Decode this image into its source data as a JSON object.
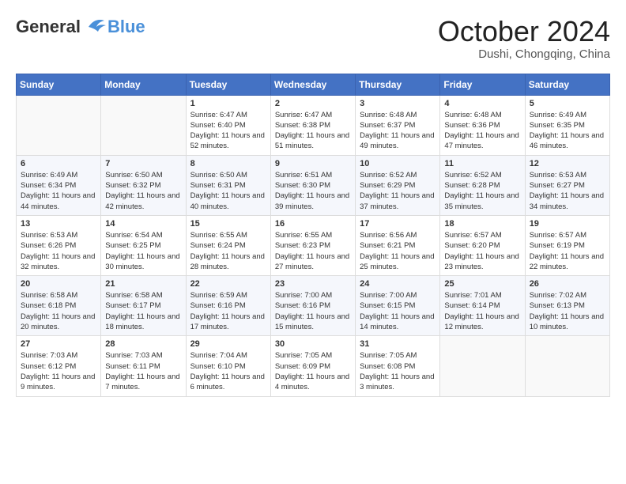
{
  "header": {
    "logo_general": "General",
    "logo_blue": "Blue",
    "month_title": "October 2024",
    "location": "Dushi, Chongqing, China"
  },
  "weekdays": [
    "Sunday",
    "Monday",
    "Tuesday",
    "Wednesday",
    "Thursday",
    "Friday",
    "Saturday"
  ],
  "weeks": [
    [
      {
        "day": "",
        "sunrise": "",
        "sunset": "",
        "daylight": ""
      },
      {
        "day": "",
        "sunrise": "",
        "sunset": "",
        "daylight": ""
      },
      {
        "day": "1",
        "sunrise": "Sunrise: 6:47 AM",
        "sunset": "Sunset: 6:40 PM",
        "daylight": "Daylight: 11 hours and 52 minutes."
      },
      {
        "day": "2",
        "sunrise": "Sunrise: 6:47 AM",
        "sunset": "Sunset: 6:38 PM",
        "daylight": "Daylight: 11 hours and 51 minutes."
      },
      {
        "day": "3",
        "sunrise": "Sunrise: 6:48 AM",
        "sunset": "Sunset: 6:37 PM",
        "daylight": "Daylight: 11 hours and 49 minutes."
      },
      {
        "day": "4",
        "sunrise": "Sunrise: 6:48 AM",
        "sunset": "Sunset: 6:36 PM",
        "daylight": "Daylight: 11 hours and 47 minutes."
      },
      {
        "day": "5",
        "sunrise": "Sunrise: 6:49 AM",
        "sunset": "Sunset: 6:35 PM",
        "daylight": "Daylight: 11 hours and 46 minutes."
      }
    ],
    [
      {
        "day": "6",
        "sunrise": "Sunrise: 6:49 AM",
        "sunset": "Sunset: 6:34 PM",
        "daylight": "Daylight: 11 hours and 44 minutes."
      },
      {
        "day": "7",
        "sunrise": "Sunrise: 6:50 AM",
        "sunset": "Sunset: 6:32 PM",
        "daylight": "Daylight: 11 hours and 42 minutes."
      },
      {
        "day": "8",
        "sunrise": "Sunrise: 6:50 AM",
        "sunset": "Sunset: 6:31 PM",
        "daylight": "Daylight: 11 hours and 40 minutes."
      },
      {
        "day": "9",
        "sunrise": "Sunrise: 6:51 AM",
        "sunset": "Sunset: 6:30 PM",
        "daylight": "Daylight: 11 hours and 39 minutes."
      },
      {
        "day": "10",
        "sunrise": "Sunrise: 6:52 AM",
        "sunset": "Sunset: 6:29 PM",
        "daylight": "Daylight: 11 hours and 37 minutes."
      },
      {
        "day": "11",
        "sunrise": "Sunrise: 6:52 AM",
        "sunset": "Sunset: 6:28 PM",
        "daylight": "Daylight: 11 hours and 35 minutes."
      },
      {
        "day": "12",
        "sunrise": "Sunrise: 6:53 AM",
        "sunset": "Sunset: 6:27 PM",
        "daylight": "Daylight: 11 hours and 34 minutes."
      }
    ],
    [
      {
        "day": "13",
        "sunrise": "Sunrise: 6:53 AM",
        "sunset": "Sunset: 6:26 PM",
        "daylight": "Daylight: 11 hours and 32 minutes."
      },
      {
        "day": "14",
        "sunrise": "Sunrise: 6:54 AM",
        "sunset": "Sunset: 6:25 PM",
        "daylight": "Daylight: 11 hours and 30 minutes."
      },
      {
        "day": "15",
        "sunrise": "Sunrise: 6:55 AM",
        "sunset": "Sunset: 6:24 PM",
        "daylight": "Daylight: 11 hours and 28 minutes."
      },
      {
        "day": "16",
        "sunrise": "Sunrise: 6:55 AM",
        "sunset": "Sunset: 6:23 PM",
        "daylight": "Daylight: 11 hours and 27 minutes."
      },
      {
        "day": "17",
        "sunrise": "Sunrise: 6:56 AM",
        "sunset": "Sunset: 6:21 PM",
        "daylight": "Daylight: 11 hours and 25 minutes."
      },
      {
        "day": "18",
        "sunrise": "Sunrise: 6:57 AM",
        "sunset": "Sunset: 6:20 PM",
        "daylight": "Daylight: 11 hours and 23 minutes."
      },
      {
        "day": "19",
        "sunrise": "Sunrise: 6:57 AM",
        "sunset": "Sunset: 6:19 PM",
        "daylight": "Daylight: 11 hours and 22 minutes."
      }
    ],
    [
      {
        "day": "20",
        "sunrise": "Sunrise: 6:58 AM",
        "sunset": "Sunset: 6:18 PM",
        "daylight": "Daylight: 11 hours and 20 minutes."
      },
      {
        "day": "21",
        "sunrise": "Sunrise: 6:58 AM",
        "sunset": "Sunset: 6:17 PM",
        "daylight": "Daylight: 11 hours and 18 minutes."
      },
      {
        "day": "22",
        "sunrise": "Sunrise: 6:59 AM",
        "sunset": "Sunset: 6:16 PM",
        "daylight": "Daylight: 11 hours and 17 minutes."
      },
      {
        "day": "23",
        "sunrise": "Sunrise: 7:00 AM",
        "sunset": "Sunset: 6:16 PM",
        "daylight": "Daylight: 11 hours and 15 minutes."
      },
      {
        "day": "24",
        "sunrise": "Sunrise: 7:00 AM",
        "sunset": "Sunset: 6:15 PM",
        "daylight": "Daylight: 11 hours and 14 minutes."
      },
      {
        "day": "25",
        "sunrise": "Sunrise: 7:01 AM",
        "sunset": "Sunset: 6:14 PM",
        "daylight": "Daylight: 11 hours and 12 minutes."
      },
      {
        "day": "26",
        "sunrise": "Sunrise: 7:02 AM",
        "sunset": "Sunset: 6:13 PM",
        "daylight": "Daylight: 11 hours and 10 minutes."
      }
    ],
    [
      {
        "day": "27",
        "sunrise": "Sunrise: 7:03 AM",
        "sunset": "Sunset: 6:12 PM",
        "daylight": "Daylight: 11 hours and 9 minutes."
      },
      {
        "day": "28",
        "sunrise": "Sunrise: 7:03 AM",
        "sunset": "Sunset: 6:11 PM",
        "daylight": "Daylight: 11 hours and 7 minutes."
      },
      {
        "day": "29",
        "sunrise": "Sunrise: 7:04 AM",
        "sunset": "Sunset: 6:10 PM",
        "daylight": "Daylight: 11 hours and 6 minutes."
      },
      {
        "day": "30",
        "sunrise": "Sunrise: 7:05 AM",
        "sunset": "Sunset: 6:09 PM",
        "daylight": "Daylight: 11 hours and 4 minutes."
      },
      {
        "day": "31",
        "sunrise": "Sunrise: 7:05 AM",
        "sunset": "Sunset: 6:08 PM",
        "daylight": "Daylight: 11 hours and 3 minutes."
      },
      {
        "day": "",
        "sunrise": "",
        "sunset": "",
        "daylight": ""
      },
      {
        "day": "",
        "sunrise": "",
        "sunset": "",
        "daylight": ""
      }
    ]
  ]
}
